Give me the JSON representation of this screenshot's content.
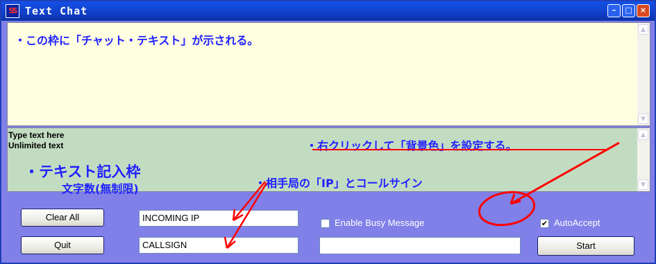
{
  "window": {
    "title": "Text  Chat",
    "app_icon": "SS",
    "controls": {
      "minimize": "–",
      "maximize": "□",
      "close": "×"
    }
  },
  "chat_pane": {
    "note": "・この枠に「チャット・テキスト」が示される。"
  },
  "input_pane": {
    "type_hint": [
      "Type text here",
      "Unlimited text"
    ],
    "note_right_click": "・右クリックして「背景色」を設定する。",
    "note_entry": "・テキスト記入枠",
    "note_count": "文字数(無制限)",
    "note_ip_callsign": "・相手局の「IP」とコールサイン"
  },
  "controls": {
    "clear_all": "Clear All",
    "quit": "Quit",
    "incoming_ip": "INCOMING IP",
    "callsign": "CALLSIGN",
    "busy_message_value": "",
    "enable_busy_label": "Enable Busy Message",
    "enable_busy_checked": false,
    "auto_accept_label": "AutoAccept",
    "auto_accept_checked": true,
    "start": "Start"
  },
  "annotation_color": "#ff0000",
  "panel_color": "#8080e8"
}
